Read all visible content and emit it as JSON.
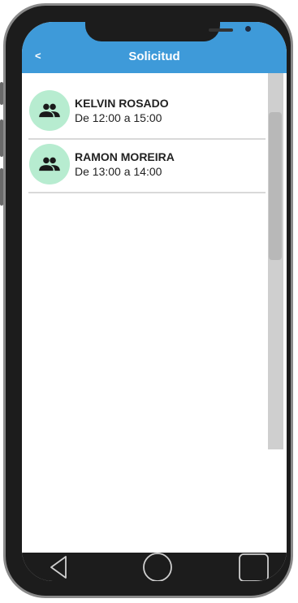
{
  "header": {
    "back_label": "<",
    "title": "Solicitud"
  },
  "requests": [
    {
      "name": "KELVIN ROSADO",
      "schedule": "De 12:00 a 15:00",
      "icon": "people-icon"
    },
    {
      "name": "RAMON MOREIRA",
      "schedule": "De 13:00 a 14:00",
      "icon": "people-icon"
    }
  ],
  "nav": {
    "buttons": [
      "back-triangle",
      "home-circle",
      "recents-square"
    ]
  },
  "colors": {
    "appbar": "#3e9ad9",
    "avatar_bg": "#b7ecd0",
    "phone_frame": "#1c1c1c"
  }
}
